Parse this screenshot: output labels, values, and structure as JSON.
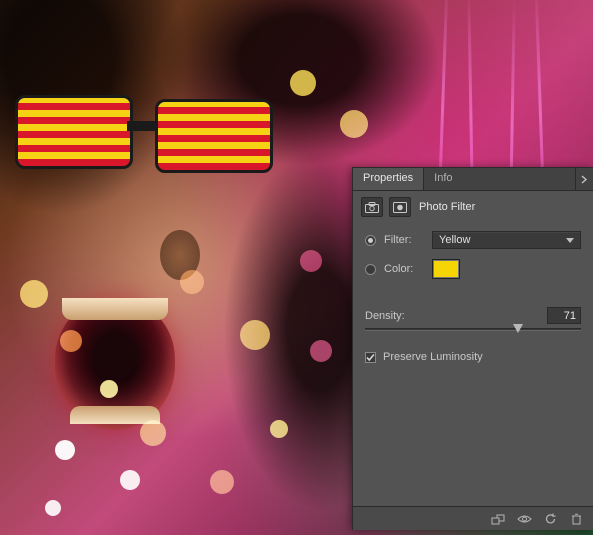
{
  "tabs": {
    "properties": "Properties",
    "info": "Info"
  },
  "header": {
    "title": "Photo Filter"
  },
  "filter": {
    "radio_label": "Filter:",
    "selected": "Yellow"
  },
  "color": {
    "radio_label": "Color:",
    "swatch_hex": "#f5d506"
  },
  "density": {
    "label": "Density:",
    "value": "71"
  },
  "preserve": {
    "label": "Preserve Luminosity",
    "checked": true
  }
}
